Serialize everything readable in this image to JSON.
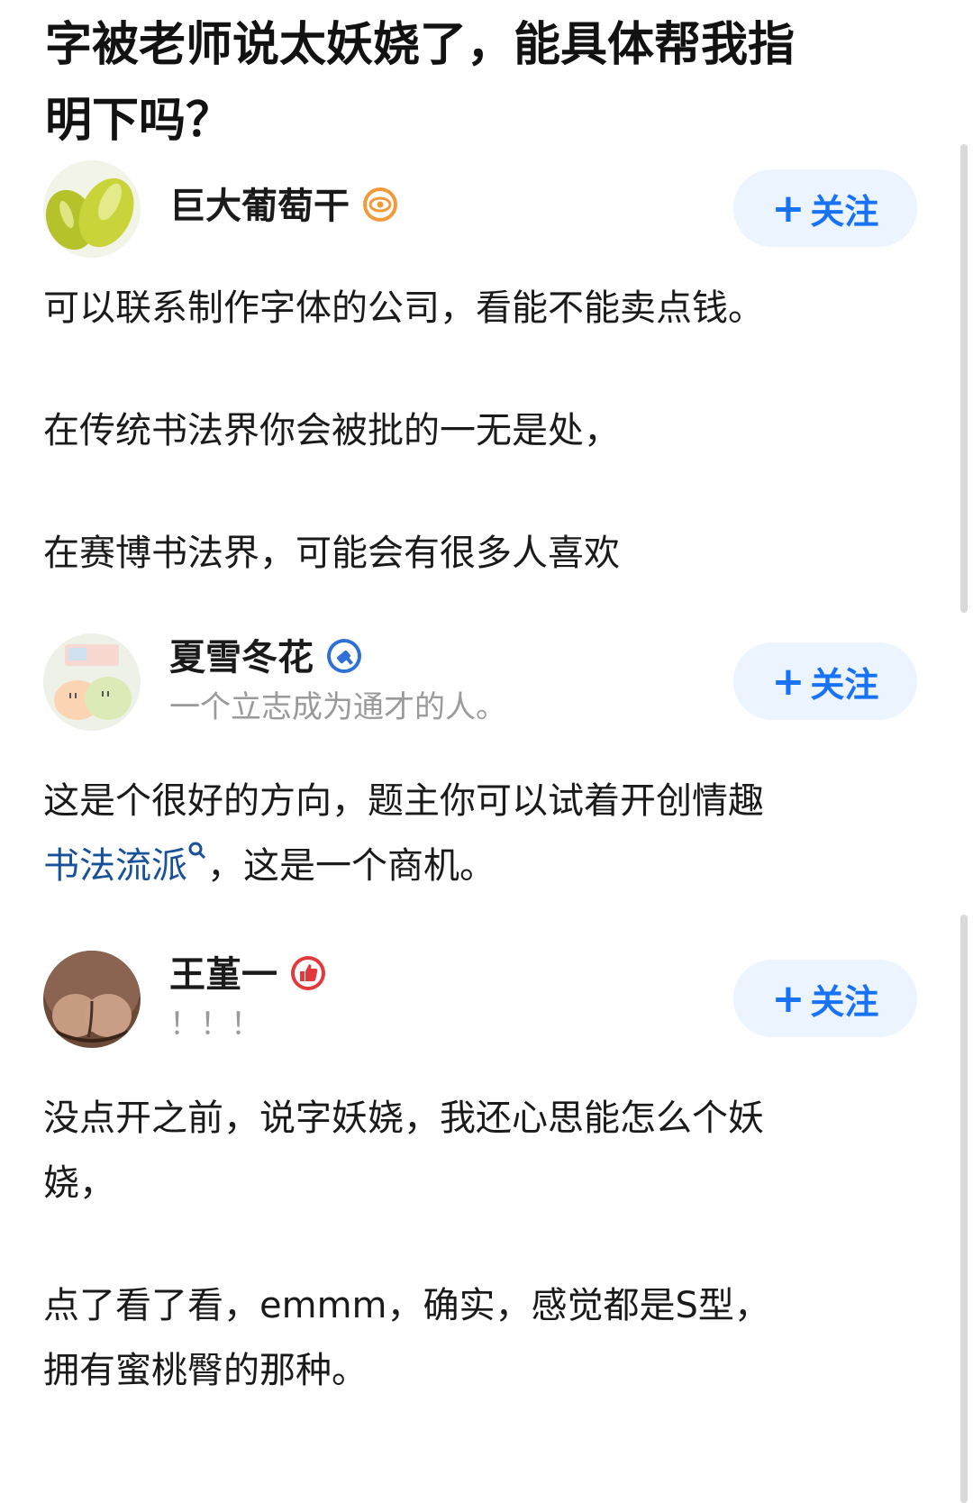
{
  "question": {
    "title_line1": "字被老师说太妖娆了，能具体帮我指",
    "title_line2": "明下吗？"
  },
  "follow_label": "关注",
  "answers": [
    {
      "author": "巨大葡萄干",
      "badge_icon": "eye-badge-icon",
      "paragraphs": [
        "可以联系制作字体的公司，看能不能卖点钱。",
        "在传统书法界你会被批的一无是处，",
        "在赛博书法界，可能会有很多人喜欢"
      ]
    },
    {
      "author": "夏雪冬花",
      "badge_icon": "hammer-badge-icon",
      "bio": "一个立志成为通才的人。",
      "line1": "这是个很好的方向，题主你可以试着开创情趣",
      "link_text": "书法流派",
      "line2_rest": "，这是一个商机。"
    },
    {
      "author": "王堇一",
      "badge_icon": "thumbs-up-badge-icon",
      "bio": "！！！",
      "paragraphs": [
        "没点开之前，说字妖娆，我还心思能怎么个妖",
        "娆，",
        "点了看了看，emmm，确实，感觉都是S型，",
        "拥有蜜桃臀的那种。"
      ]
    }
  ],
  "colors": {
    "accent": "#1772f6",
    "button_bg": "#ebf4ff",
    "link": "#175199",
    "muted": "#9a9a9a"
  }
}
